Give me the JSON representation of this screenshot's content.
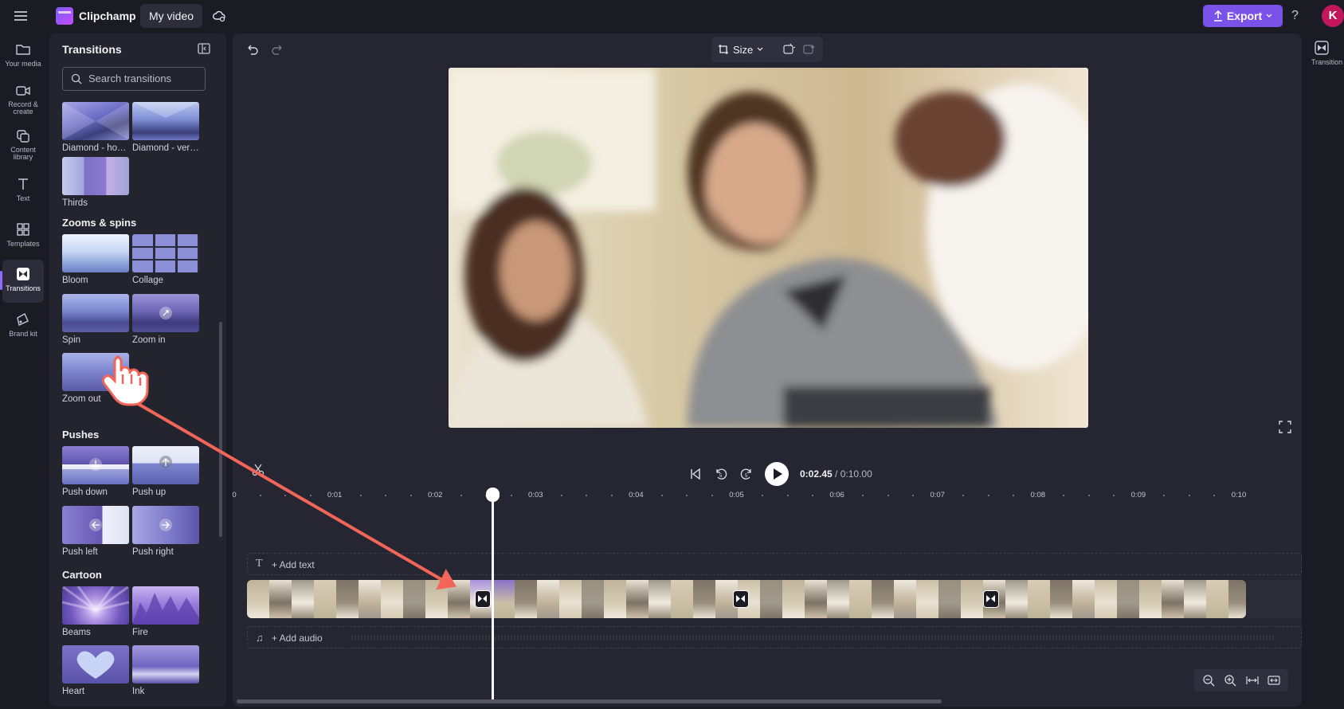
{
  "app": {
    "name": "Clipchamp",
    "project_name": "My video"
  },
  "topbar": {
    "export_label": "Export",
    "help_label": "?",
    "avatar_initial": "K"
  },
  "left_rail": {
    "items": [
      {
        "label": "Your media",
        "icon": "folder-icon"
      },
      {
        "label": "Record & create",
        "icon": "camera-icon"
      },
      {
        "label": "Content library",
        "icon": "library-icon"
      },
      {
        "label": "Text",
        "icon": "text-icon"
      },
      {
        "label": "Templates",
        "icon": "templates-icon"
      },
      {
        "label": "Transitions",
        "icon": "transitions-icon",
        "active": true
      },
      {
        "label": "Brand kit",
        "icon": "brand-kit-icon"
      }
    ]
  },
  "panel": {
    "title": "Transitions",
    "search_placeholder": "Search transitions",
    "tiles_top": [
      {
        "label": "Diamond - hori..."
      },
      {
        "label": "Diamond - vert..."
      },
      {
        "label": "Thirds"
      }
    ],
    "sections": [
      {
        "title": "Zooms & spins",
        "tiles": [
          {
            "label": "Bloom"
          },
          {
            "label": "Collage"
          },
          {
            "label": "Spin"
          },
          {
            "label": "Zoom in"
          },
          {
            "label": "Zoom out"
          }
        ]
      },
      {
        "title": "Pushes",
        "tiles": [
          {
            "label": "Push down"
          },
          {
            "label": "Push up"
          },
          {
            "label": "Push left"
          },
          {
            "label": "Push right"
          }
        ]
      },
      {
        "title": "Cartoon",
        "tiles": [
          {
            "label": "Beams"
          },
          {
            "label": "Fire"
          },
          {
            "label": "Heart"
          },
          {
            "label": "Ink"
          }
        ]
      }
    ]
  },
  "toolbar": {
    "size_label": "Size"
  },
  "player": {
    "current_time": "0:02.45",
    "total_time": "/ 0:10.00"
  },
  "timeline": {
    "ruler_labels": [
      "0",
      "0:01",
      "0:02",
      "0:03",
      "0:04",
      "0:05",
      "0:06",
      "0:07",
      "0:08",
      "0:09",
      "0:10"
    ],
    "add_text_label": "+ Add text",
    "add_audio_label": "+ Add audio"
  },
  "right_rail": {
    "label": "Transition"
  },
  "colors": {
    "accent": "#7b52e8",
    "avatar": "#c2185b",
    "pointer_arrow": "#f2665a"
  }
}
